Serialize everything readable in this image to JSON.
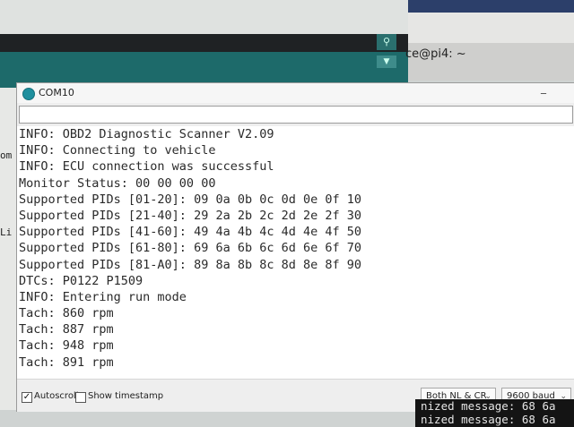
{
  "background": {
    "right_window_title": "ce@pi4: ~",
    "left_fragments": [
      "om",
      "Li"
    ]
  },
  "window": {
    "title": "COM10",
    "minimize_label": "_"
  },
  "send_input": {
    "value": ""
  },
  "output_lines": [
    "INFO: OBD2 Diagnostic Scanner V2.09",
    "INFO: Connecting to vehicle",
    "INFO: ECU connection was successful",
    "Monitor Status: 00 00 00 00",
    "Supported PIDs [01-20]: 09 0a 0b 0c 0d 0e 0f 10",
    "Supported PIDs [21-40]: 29 2a 2b 2c 2d 2e 2f 30",
    "Supported PIDs [41-60]: 49 4a 4b 4c 4d 4e 4f 50",
    "Supported PIDs [61-80]: 69 6a 6b 6c 6d 6e 6f 70",
    "Supported PIDs [81-A0]: 89 8a 8b 8c 8d 8e 8f 90",
    "DTCs: P0122 P1509",
    "INFO: Entering run mode",
    "Tach: 860 rpm",
    "Tach: 887 rpm",
    "Tach: 948 rpm",
    "Tach: 891 rpm"
  ],
  "footer": {
    "autoscroll_label": "Autoscroll",
    "autoscroll_checked": true,
    "timestamp_label": "Show timestamp",
    "timestamp_checked": false,
    "line_ending": "Both NL & CR",
    "baud_rate": "9600 baud"
  },
  "terminal": {
    "lines": [
      "nized message: 68 6a",
      "nized message: 68 6a"
    ]
  },
  "colors": {
    "accent_teal": "#1d6a6a",
    "terminal_bg": "#141414"
  }
}
